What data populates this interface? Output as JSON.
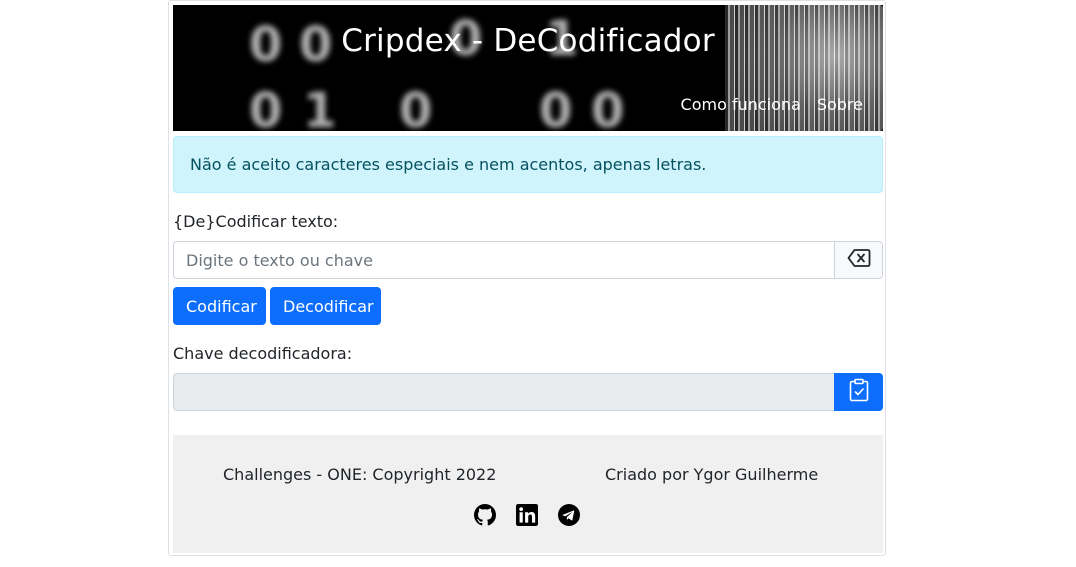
{
  "header": {
    "title": "Cripdex - DeCodificador",
    "nav": [
      "Como funciona",
      "Sobre"
    ],
    "background_digits": [
      "0",
      "0",
      "0",
      "1",
      "0",
      "1",
      "0",
      "0",
      "0"
    ]
  },
  "alert": {
    "text": "Não é aceito caracteres especiais e nem acentos, apenas letras."
  },
  "encode": {
    "label": "{De}Codificar texto:",
    "placeholder": "Digite o texto ou chave",
    "value": "",
    "clear_icon": "backspace-icon"
  },
  "buttons": {
    "encode": "Codificar",
    "decode": "Decodificar"
  },
  "key": {
    "label": "Chave decodificadora:",
    "value": "",
    "copy_icon": "clipboard-check-icon"
  },
  "footer": {
    "left": "Challenges - ONE: Copyright 2022",
    "right": "Criado por Ygor Guilherme",
    "icons": [
      "github-icon",
      "linkedin-icon",
      "telegram-icon"
    ]
  },
  "colors": {
    "primary": "#0d6efd",
    "alert_bg": "#cff4fc",
    "alert_text": "#055160",
    "footer_bg": "#f0f0f0"
  }
}
